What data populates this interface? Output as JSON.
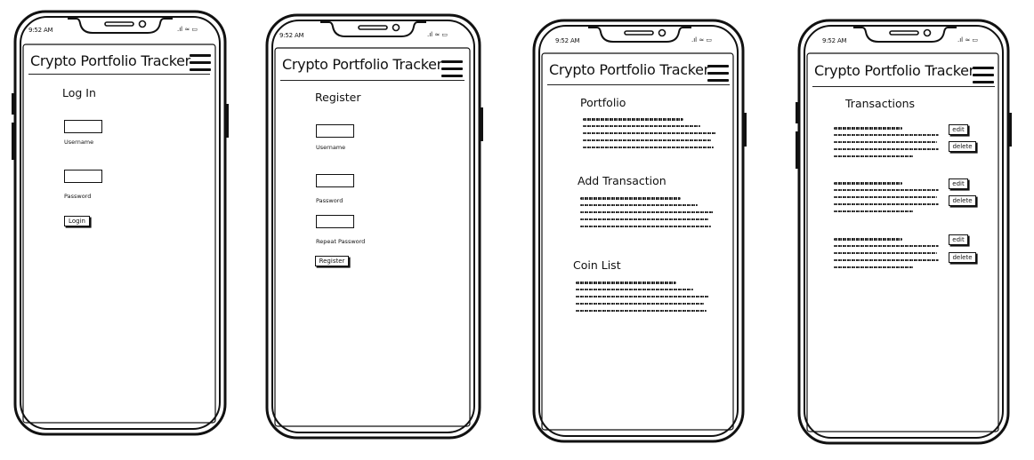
{
  "screens": [
    {
      "status_time": "9:52 AM",
      "header_title": "Crypto Portfolio Tracker",
      "page_title": "Log In",
      "fields": [
        {
          "label": "Username",
          "value": ""
        },
        {
          "label": "Password",
          "value": ""
        }
      ],
      "submit_label": "Login"
    },
    {
      "status_time": "9:52 AM",
      "header_title": "Crypto Portfolio Tracker",
      "page_title": "Register",
      "fields": [
        {
          "label": "Username",
          "value": ""
        },
        {
          "label": "Password",
          "value": ""
        },
        {
          "label": "Repeat Password",
          "value": ""
        }
      ],
      "submit_label": "Register"
    },
    {
      "status_time": "9:52 AM",
      "header_title": "Crypto Portfolio Tracker",
      "sections": [
        {
          "heading": "Portfolio"
        },
        {
          "heading": "Add Transaction"
        },
        {
          "heading": "Coin List"
        }
      ]
    },
    {
      "status_time": "9:52 AM",
      "header_title": "Crypto Portfolio Tracker",
      "page_title": "Transactions",
      "edit_label": "edit",
      "delete_label": "delete"
    }
  ]
}
